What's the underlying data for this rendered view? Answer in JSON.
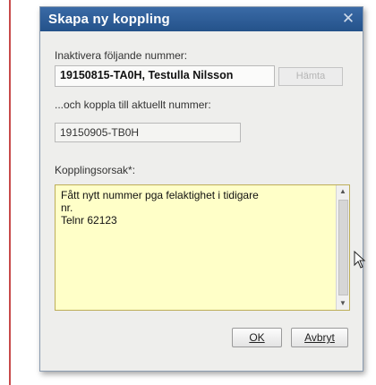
{
  "dialog": {
    "title": "Skapa ny koppling",
    "close_glyph": "✕",
    "inactivate_label": "Inaktivera följande nummer:",
    "inactivate_value": "19150815-TA0H, Testulla Nilsson",
    "fetch_label": "Hämta",
    "connect_label": "...och koppla till aktuellt nummer:",
    "connect_value": "19150905-TB0H",
    "reason_label": "Kopplingsorsak*:",
    "reason_text": "Fått nytt nummer pga felaktighet i tidigare\nnr.\nTelnr 62123",
    "ok_label": "OK",
    "cancel_label": "Avbryt"
  },
  "colors": {
    "titlebar": "#2b5c96",
    "textarea_bg": "#ffffc8",
    "side_rule": "#c84a4a"
  }
}
